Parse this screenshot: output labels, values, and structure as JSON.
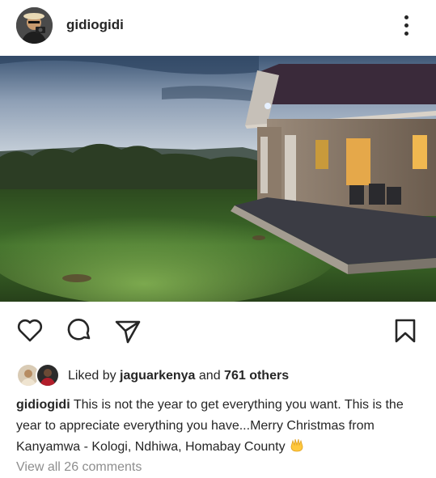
{
  "post": {
    "username": "gidiogidi",
    "photo_alt": "Photo",
    "likes": {
      "prefix": "Liked by",
      "user": "jaguarkenya",
      "connector": "and",
      "count_text": "761 others"
    },
    "caption": {
      "username": "gidiogidi",
      "text": "This is not the year to get everything you want. This is the year to appreciate everything you have...Merry Christmas from Kanyamwa - Kologi, Ndhiwa, Homabay County"
    },
    "view_comments": "View all 26 comments"
  },
  "icons": {
    "more": "more-vertical-icon",
    "like": "heart-icon",
    "comment": "comment-icon",
    "share": "paper-plane-icon",
    "save": "bookmark-icon",
    "emoji": "hands-emoji"
  },
  "colors": {
    "text": "#262626",
    "muted": "#8e8e8e",
    "background": "#ffffff"
  }
}
